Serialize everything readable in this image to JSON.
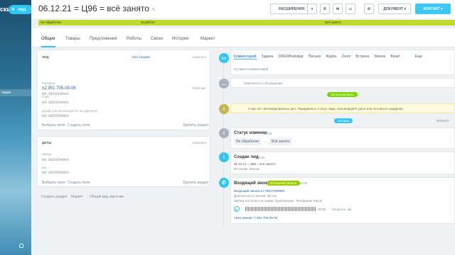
{
  "sidebar": {
    "text": "ски",
    "menu_item": "тание",
    "pill_label": "лид"
  },
  "header": {
    "title": "06.12.21 = Ц96 = всё занято",
    "btn_ext": "РАСШИРЕНИЯ",
    "btn_doc": "ДОКУМЕНТ",
    "btn_contact": "КОНТАКТ"
  },
  "stages": [
    {
      "label": "Не обработан"
    },
    {
      "label": "В работе"
    },
    {
      "label": "Всё занято"
    }
  ],
  "tabs": [
    "Общие",
    "Товары",
    "Предложения",
    "Роботы",
    "Связи",
    "История",
    "Маркет"
  ],
  "lead_card": {
    "title": "ЛИД",
    "badge": "AI24-скоринг",
    "edit": "изменить",
    "name_label": "Имя",
    "name_value": "не заполнено",
    "phone_label": "Телефон",
    "phone_value": "+7 951 705-09-06",
    "phone_type": "Рабочий",
    "site_label": "Сайт",
    "site_value": "не заполнено",
    "google_label": "google (не используется, не удалено)",
    "google_value": "не заполнено",
    "choose": "Выбрать поля",
    "create": "Создать поле",
    "delete": "Удалить раздел"
  },
  "deals_card": {
    "title": "ДЕТЫ",
    "edit": "изменить",
    "f1_label": "Завод",
    "f1_value": "не заполнено",
    "f2_label": "Вы...",
    "f2_value": "не заполнено",
    "choose": "Выбрать поля",
    "create": "Создать поле",
    "delete": "Удалить раздел"
  },
  "footer": {
    "create_section": "Создать раздел",
    "market": "Маркет",
    "common": "Общий вид карточки"
  },
  "activity": {
    "tabs": [
      "Комментарий",
      "Задача",
      "SMS/WhatsApp",
      "Письмо",
      "Ждать",
      "Zoom",
      "Встреча",
      "Звонок",
      "Визит",
      "Еще"
    ],
    "placeholder": "Оставьте комментарий",
    "invite": "Пригласить к обсуждению",
    "planned_tag": "Запланировано",
    "warning": "У вас нет запланированных дел. Передвиньте статус лида, запланируйте дело или поставьте ожидание.",
    "today_tag": "сегодня",
    "filter": "ФИЛЬТР"
  },
  "events": [
    {
      "title": "Статус изменен",
      "time": "15:24",
      "from": "Не обработан",
      "to": "Всё занято"
    },
    {
      "title": "Создан лид",
      "time": "12:31",
      "line1": "06.12.21 = Ц96 = всё занято",
      "line2": "Источник: Звонок"
    },
    {
      "title": "Входящий звонок",
      "tag": "Успешный звонок",
      "time": "12:31",
      "line1": "Входящий звонок от 79517050906",
      "line2": "Длительность звонка: 58 сек.",
      "line3": "Звонок поступил на номер: Приложение: Телефония Sipuni",
      "duration": "00:58",
      "speed": "Скорость",
      "speed_val": "1x",
      "footer": "<Без имени> 7 951 705-09-06"
    }
  ],
  "colors": {
    "accent": "#2fc6f6",
    "stage": "#c2d82e",
    "planned": "#7bd500"
  }
}
